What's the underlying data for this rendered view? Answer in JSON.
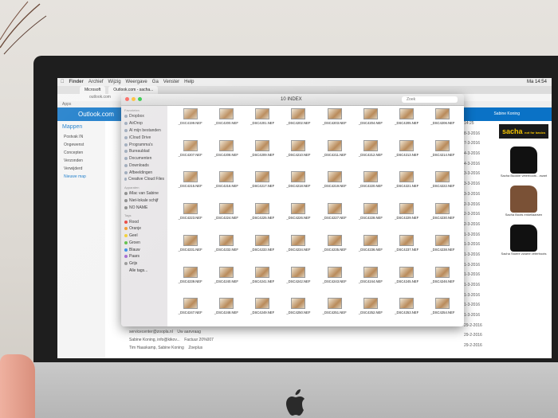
{
  "menubar": {
    "items": [
      "Finder",
      "Archief",
      "Wijzig",
      "Weergave",
      "Ga",
      "Venster",
      "Help"
    ],
    "clock": "Ma 14:54"
  },
  "browser": {
    "tabs": [
      "Microsoft",
      "Outlook.com - sacha..."
    ],
    "url": "outlook.com",
    "bookmark": "Apps"
  },
  "outlook": {
    "brand": "Outlook.com",
    "user": "Sabine Koning",
    "folders_title": "Mappen",
    "folders": [
      "Postvak IN",
      "Ongewenst",
      "Concepten",
      "Verzonden",
      "Verwijderd",
      "Nieuwe map"
    ],
    "mails": [
      {
        "from": "servicecenter@zoopla.nl",
        "subject": "Uw aanvraag"
      },
      {
        "from": "Sabine Koning, info@kikov...",
        "subject": "Factuur 20%007"
      },
      {
        "from": "Tim Haaskamp, Sabine Koning",
        "subject": "Zoeplus"
      }
    ],
    "dates": [
      "14:25",
      "8-3-2016",
      "7-3-2016",
      "4-3-2016",
      "4-3-2016",
      "3-3-2016",
      "3-3-2016",
      "3-3-2016",
      "2-3-2016",
      "2-3-2016",
      "2-3-2016",
      "1-3-2016",
      "1-3-2016",
      "1-3-2016",
      "1-3-2016",
      "1-3-2016",
      "1-3-2016",
      "1-3-2016",
      "1-3-2016",
      "1-3-2016",
      "29-2-2016",
      "29-2-2016",
      "29-2-2016"
    ]
  },
  "ad": {
    "brand": "sacha",
    "tagline": "not for basics",
    "products": [
      "Sacha Bucklie veterboots - zwart",
      "Sacha Boots enkellaarsen",
      "Sacha Stoere zwarte veterboots"
    ]
  },
  "finder": {
    "title": "10 INDEX",
    "search_placeholder": "Zoek",
    "favorites_title": "Favorieten",
    "favorites": [
      "Dropbox",
      "AirDrop",
      "Al mijn bestanden",
      "iCloud Drive",
      "Programma's",
      "Bureaublad",
      "Documenten",
      "Downloads",
      "Afbeeldingen",
      "Creative Cloud Files"
    ],
    "devices_title": "Apparaten",
    "devices": [
      "iMac van Sabine",
      "Niet-lokale schijf",
      "NO NAME"
    ],
    "tags_title": "Tags",
    "tags": [
      {
        "label": "Rood",
        "color": "#e8463f"
      },
      {
        "label": "Oranje",
        "color": "#f39a2b"
      },
      {
        "label": "Geel",
        "color": "#f2cf33"
      },
      {
        "label": "Groen",
        "color": "#5fbf4a"
      },
      {
        "label": "Blauw",
        "color": "#3a8ee6"
      },
      {
        "label": "Paars",
        "color": "#a46bd1"
      },
      {
        "label": "Grijs",
        "color": "#9a9a9a"
      },
      {
        "label": "Alle tags...",
        "color": ""
      }
    ],
    "files": [
      "_DSC4199.NEF",
      "_DSC4200.NEF",
      "_DSC4201.NEF",
      "_DSC4202.NEF",
      "_DSC4203.NEF",
      "_DSC4204.NEF",
      "_DSC4205.NEF",
      "_DSC4206.NEF",
      "_DSC4207.NEF",
      "_DSC4208.NEF",
      "_DSC4209.NEF",
      "_DSC4210.NEF",
      "_DSC4211.NEF",
      "_DSC4212.NEF",
      "_DSC4213.NEF",
      "_DSC4214.NEF",
      "_DSC4215.NEF",
      "_DSC4216.NEF",
      "_DSC4217.NEF",
      "_DSC4218.NEF",
      "_DSC4219.NEF",
      "_DSC4220.NEF",
      "_DSC4221.NEF",
      "_DSC4222.NEF",
      "_DSC4223.NEF",
      "_DSC4224.NEF",
      "_DSC4225.NEF",
      "_DSC4226.NEF",
      "_DSC4227.NEF",
      "_DSC4228.NEF",
      "_DSC4229.NEF",
      "_DSC4230.NEF",
      "_DSC4231.NEF",
      "_DSC4232.NEF",
      "_DSC4233.NEF",
      "_DSC4234.NEF",
      "_DSC4235.NEF",
      "_DSC4236.NEF",
      "_DSC4237.NEF",
      "_DSC4238.NEF",
      "_DSC4239.NEF",
      "_DSC4240.NEF",
      "_DSC4241.NEF",
      "_DSC4242.NEF",
      "_DSC4243.NEF",
      "_DSC4244.NEF",
      "_DSC4245.NEF",
      "_DSC4246.NEF",
      "_DSC4247.NEF",
      "_DSC4248.NEF",
      "_DSC4249.NEF",
      "_DSC4250.NEF",
      "_DSC4251.NEF",
      "_DSC4252.NEF",
      "_DSC4253.NEF",
      "_DSC4254.NEF"
    ]
  }
}
